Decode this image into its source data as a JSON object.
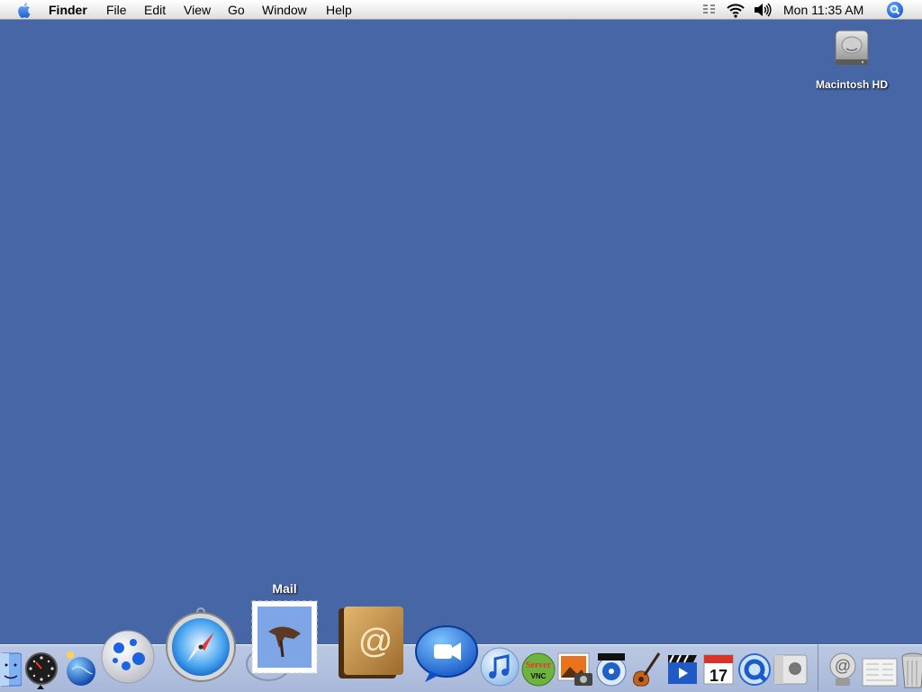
{
  "menubar": {
    "app_name": "Finder",
    "menus": [
      "File",
      "Edit",
      "View",
      "Go",
      "Window",
      "Help"
    ],
    "clock": "Mon 11:35 AM",
    "status_icons": [
      "keyboard-menu-icon",
      "wifi-icon",
      "volume-icon",
      "spotlight-icon"
    ]
  },
  "desktop": {
    "background_color": "#4766a6",
    "icons": [
      {
        "label": "Macintosh HD",
        "icon": "hard-drive-icon"
      }
    ]
  },
  "dock": {
    "hover_tooltip": "Mail",
    "items": [
      {
        "name": "finder-icon"
      },
      {
        "name": "dashboard-icon"
      },
      {
        "name": "network-app-icon"
      },
      {
        "name": "blue-app-icon"
      },
      {
        "name": "safari-icon"
      },
      {
        "name": "mail-icon"
      },
      {
        "name": "address-book-icon"
      },
      {
        "name": "ichat-icon"
      },
      {
        "name": "itunes-icon"
      },
      {
        "name": "vnc-server-icon",
        "text": "Server"
      },
      {
        "name": "iphoto-icon"
      },
      {
        "name": "dvd-player-icon"
      },
      {
        "name": "garageband-icon"
      },
      {
        "name": "imovie-icon"
      },
      {
        "name": "ical-icon",
        "text": "17"
      },
      {
        "name": "quicktime-icon"
      },
      {
        "name": "system-preferences-icon"
      },
      {
        "name": "mail-drive-icon"
      },
      {
        "name": "documents-folder-icon"
      },
      {
        "name": "trash-icon"
      }
    ]
  }
}
